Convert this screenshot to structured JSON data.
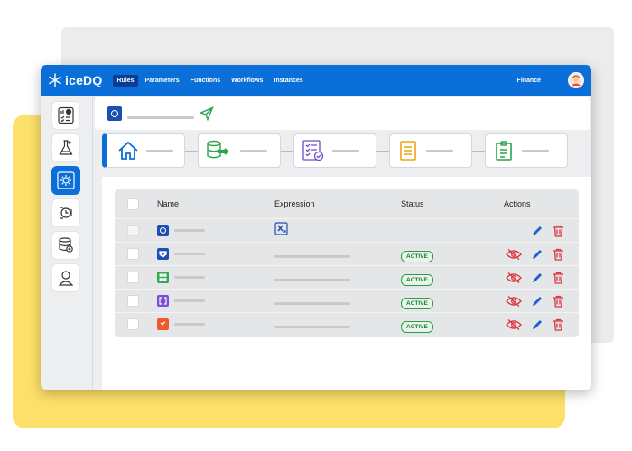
{
  "app": {
    "brand": "iceDQ",
    "nav": [
      "Rules",
      "Parameters",
      "Functions",
      "Workflows",
      "Instances"
    ],
    "active_nav": "Rules",
    "org": "Finance"
  },
  "sidebar": {
    "items": [
      {
        "name": "dashboard-icon",
        "selected": false
      },
      {
        "name": "lab-flask-icon",
        "selected": false
      },
      {
        "name": "rules-gear-icon",
        "selected": true
      },
      {
        "name": "scheduler-icon",
        "selected": false
      },
      {
        "name": "database-icon",
        "selected": false
      },
      {
        "name": "user-icon",
        "selected": false
      }
    ]
  },
  "table": {
    "headers": {
      "name": "Name",
      "expression": "Expression",
      "status": "Status",
      "actions": "Actions"
    },
    "rows": [
      {
        "icon": "circle-icon",
        "color": "#1e4fb4",
        "status": ""
      },
      {
        "icon": "shield-check-icon",
        "color": "#1e4fb4",
        "status": "ACTIVE"
      },
      {
        "icon": "grid-icon",
        "color": "#34a853",
        "status": "ACTIVE"
      },
      {
        "icon": "brackets-icon",
        "color": "#7b4fd6",
        "status": "ACTIVE"
      },
      {
        "icon": "branch-icon",
        "color": "#f0582b",
        "status": "ACTIVE"
      }
    ]
  },
  "colors": {
    "brand_blue": "#0a6fd8",
    "active_green": "#2a9d45",
    "danger_red": "#d9363e",
    "edit_blue": "#1e5fd9"
  }
}
